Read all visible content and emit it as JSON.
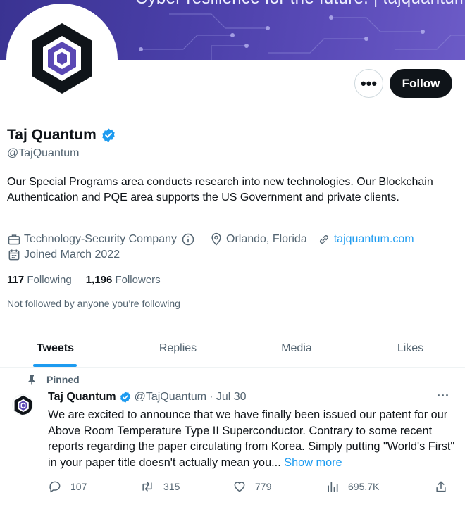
{
  "banner": {
    "text": "Cyber resilience for the future. | tajquantum.com"
  },
  "profile": {
    "name": "Taj Quantum",
    "handle": "@TajQuantum",
    "follow_label": "Follow",
    "more_label": "•••",
    "bio": "Our Special Programs area conducts research into new technologies. Our Blockchain Authentication and PQE area supports the US Government and private clients.",
    "category": "Technology-Security Company",
    "location": "Orlando, Florida",
    "website": "tajquantum.com",
    "joined": "Joined March 2022",
    "following_count": "117",
    "following_label": "Following",
    "followers_count": "1,196",
    "followers_label": "Followers",
    "not_followed": "Not followed by anyone you’re following"
  },
  "tabs": [
    {
      "label": "Tweets",
      "active": true
    },
    {
      "label": "Replies"
    },
    {
      "label": "Media"
    },
    {
      "label": "Likes"
    }
  ],
  "tweet": {
    "pinned_label": "Pinned",
    "author": "Taj Quantum",
    "handle": "@TajQuantum",
    "date": "· Jul 30",
    "more": "···",
    "text": "We are excited to announce that we have finally been issued our patent for our Above Room Temperature Type II Superconductor. Contrary to some recent reports regarding the paper circulating from Korea. Simply putting \"World's First\" in your paper title doesn't actually mean you...",
    "show_more": "Show more",
    "replies": "107",
    "retweets": "315",
    "likes": "779",
    "views": "695.7K"
  },
  "colors": {
    "accent": "#1d9bf0",
    "text": "#0f1419",
    "muted": "#536471",
    "logo": "#4b3fa3"
  }
}
